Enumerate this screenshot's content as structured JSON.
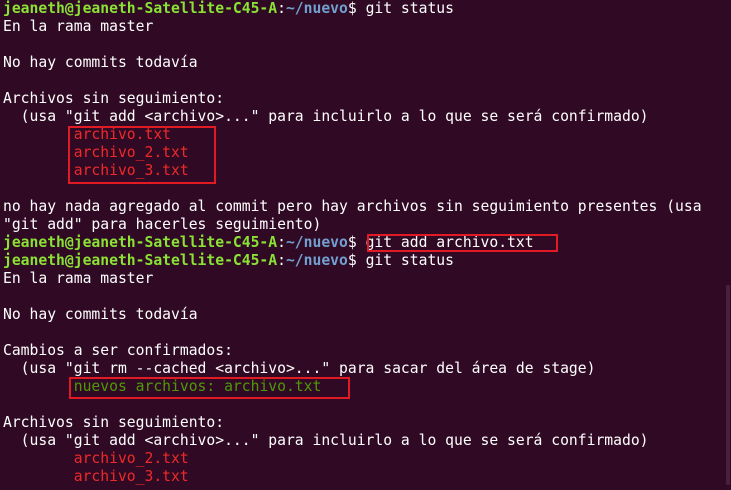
{
  "prompt": {
    "user_host": "jeaneth@jeaneth-Satellite-C45-A",
    "colon": ":",
    "path": "~/nuevo",
    "symbol": "$ "
  },
  "commands": {
    "cmd1": "git status",
    "cmd2": "git add archivo.txt",
    "cmd3": "git status"
  },
  "output1": {
    "branch": "En la rama master",
    "no_commits": "No hay commits todavía",
    "untracked_header": "Archivos sin seguimiento:",
    "untracked_hint": "  (usa \"git add <archivo>...\" para incluirlo a lo que se será confirmado)",
    "files": [
      "archivo.txt",
      "archivo_2.txt",
      "archivo_3.txt"
    ],
    "nothing_added_1": "no hay nada agregado al commit pero hay archivos sin seguimiento presentes (usa",
    "nothing_added_2": "\"git add\" para hacerles seguimiento)"
  },
  "output2": {
    "branch": "En la rama master",
    "no_commits": "No hay commits todavía",
    "staged_header": "Cambios a ser confirmados:",
    "staged_hint": "  (usa \"git rm --cached <archivo>...\" para sacar del área de stage)",
    "staged_file": "nuevos archivos: archivo.txt",
    "untracked_header": "Archivos sin seguimiento:",
    "untracked_hint": "  (usa \"git add <archivo>...\" para incluirlo a lo que se será confirmado)",
    "files": [
      "archivo_2.txt",
      "archivo_3.txt"
    ]
  },
  "colors": {
    "background": "#300a24",
    "prompt_user": "#8ae234",
    "prompt_path": "#729fcf",
    "untracked": "#ef2929",
    "staged": "#4e9a06",
    "highlight_box": "#e01b24"
  }
}
